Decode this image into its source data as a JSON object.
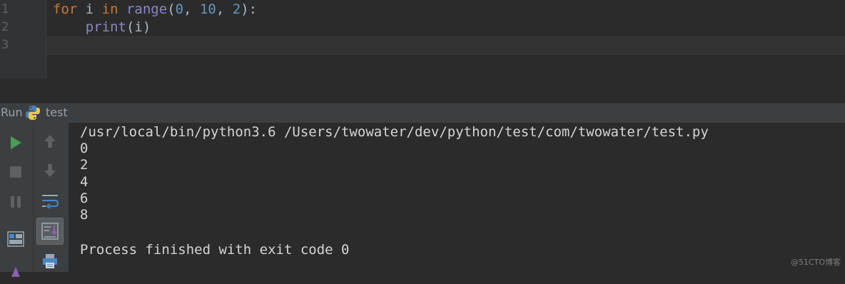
{
  "editor": {
    "line_numbers": [
      "1",
      "2",
      "3"
    ],
    "code": {
      "line1": {
        "kw_for": "for",
        "var_i": " i ",
        "kw_in": "in",
        "fn_range": " range",
        "open": "(",
        "n0": "0",
        "c1": ", ",
        "n10": "10",
        "c2": ", ",
        "n2": "2",
        "close": "):"
      },
      "line2": {
        "indent": "    ",
        "fn_print": "print",
        "args": "(i)"
      }
    }
  },
  "run_panel": {
    "label": "Run",
    "config_name": "test",
    "config_icon": "python-icon"
  },
  "toolbar": {
    "left": [
      "run-icon",
      "stop-icon",
      "pause-icon",
      "layout-icon",
      "pin-icon"
    ],
    "right": [
      "up-arrow-icon",
      "down-arrow-icon",
      "soft-wrap-icon",
      "scroll-to-end-icon",
      "print-icon"
    ]
  },
  "console": {
    "command": "/usr/local/bin/python3.6 /Users/twowater/dev/python/test/com/twowater/test.py",
    "output": [
      "0",
      "2",
      "4",
      "6",
      "8"
    ],
    "exit_message": "Process finished with exit code 0"
  },
  "watermark": "@51CTO博客",
  "colors": {
    "keyword": "#cc7832",
    "builtin": "#8888c6",
    "number": "#6897bb",
    "run_green": "#499c54"
  }
}
